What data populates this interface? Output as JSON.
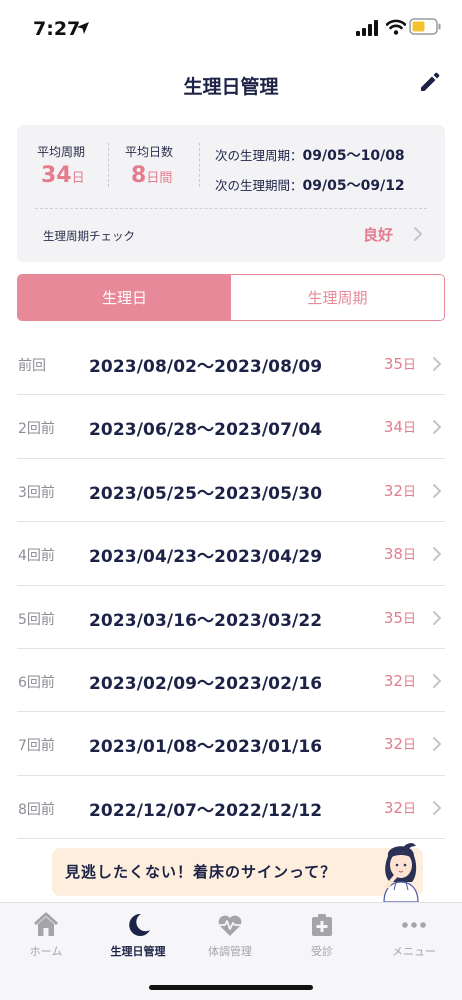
{
  "status_bar": {
    "time": "7:27"
  },
  "header": {
    "title": "生理日管理"
  },
  "summary": {
    "avg_cycle": {
      "label": "平均周期",
      "value": "34",
      "unit": "日"
    },
    "avg_days": {
      "label": "平均日数",
      "value": "8",
      "unit": "日間"
    },
    "next_cycle": {
      "label": "次の生理周期：",
      "value": "09/05〜10/08"
    },
    "next_period": {
      "label": "次の生理期間：",
      "value": "09/05〜09/12"
    },
    "check": {
      "label": "生理周期チェック",
      "value": "良好"
    }
  },
  "tabs": [
    {
      "label": "生理日",
      "active": true
    },
    {
      "label": "生理周期",
      "active": false
    }
  ],
  "history": [
    {
      "label": "前回",
      "range": "2023/08/02〜2023/08/09",
      "days": "35",
      "unit": "日"
    },
    {
      "label": "2回前",
      "range": "2023/06/28〜2023/07/04",
      "days": "34",
      "unit": "日"
    },
    {
      "label": "3回前",
      "range": "2023/05/25〜2023/05/30",
      "days": "32",
      "unit": "日"
    },
    {
      "label": "4回前",
      "range": "2023/04/23〜2023/04/29",
      "days": "38",
      "unit": "日"
    },
    {
      "label": "5回前",
      "range": "2023/03/16〜2023/03/22",
      "days": "35",
      "unit": "日"
    },
    {
      "label": "6回前",
      "range": "2023/02/09〜2023/02/16",
      "days": "32",
      "unit": "日"
    },
    {
      "label": "7回前",
      "range": "2023/01/08〜2023/01/16",
      "days": "32",
      "unit": "日"
    },
    {
      "label": "8回前",
      "range": "2022/12/07〜2022/12/12",
      "days": "32",
      "unit": "日"
    }
  ],
  "banner": {
    "text": "見逃したくない！着床のサインって？"
  },
  "tabbar": [
    {
      "label": "ホーム",
      "icon": "home-icon"
    },
    {
      "label": "生理日管理",
      "icon": "moon-icon",
      "active": true
    },
    {
      "label": "体調管理",
      "icon": "heart-pulse-icon"
    },
    {
      "label": "受診",
      "icon": "medical-cross-icon"
    },
    {
      "label": "メニュー",
      "icon": "more-dots-icon"
    }
  ],
  "colors": {
    "accent_pink": "#e8899a",
    "navy": "#1d2347",
    "banner_bg": "#fdeedd"
  }
}
